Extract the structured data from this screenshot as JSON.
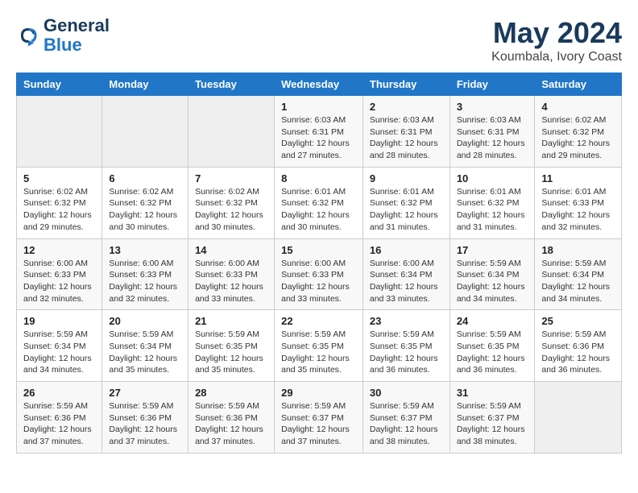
{
  "logo": {
    "line1": "General",
    "line2": "Blue"
  },
  "title": "May 2024",
  "subtitle": "Koumbala, Ivory Coast",
  "days_of_week": [
    "Sunday",
    "Monday",
    "Tuesday",
    "Wednesday",
    "Thursday",
    "Friday",
    "Saturday"
  ],
  "weeks": [
    [
      {
        "day": "",
        "sunrise": "",
        "sunset": "",
        "daylight": ""
      },
      {
        "day": "",
        "sunrise": "",
        "sunset": "",
        "daylight": ""
      },
      {
        "day": "",
        "sunrise": "",
        "sunset": "",
        "daylight": ""
      },
      {
        "day": "1",
        "sunrise": "Sunrise: 6:03 AM",
        "sunset": "Sunset: 6:31 PM",
        "daylight": "Daylight: 12 hours and 27 minutes."
      },
      {
        "day": "2",
        "sunrise": "Sunrise: 6:03 AM",
        "sunset": "Sunset: 6:31 PM",
        "daylight": "Daylight: 12 hours and 28 minutes."
      },
      {
        "day": "3",
        "sunrise": "Sunrise: 6:03 AM",
        "sunset": "Sunset: 6:31 PM",
        "daylight": "Daylight: 12 hours and 28 minutes."
      },
      {
        "day": "4",
        "sunrise": "Sunrise: 6:02 AM",
        "sunset": "Sunset: 6:32 PM",
        "daylight": "Daylight: 12 hours and 29 minutes."
      }
    ],
    [
      {
        "day": "5",
        "sunrise": "Sunrise: 6:02 AM",
        "sunset": "Sunset: 6:32 PM",
        "daylight": "Daylight: 12 hours and 29 minutes."
      },
      {
        "day": "6",
        "sunrise": "Sunrise: 6:02 AM",
        "sunset": "Sunset: 6:32 PM",
        "daylight": "Daylight: 12 hours and 30 minutes."
      },
      {
        "day": "7",
        "sunrise": "Sunrise: 6:02 AM",
        "sunset": "Sunset: 6:32 PM",
        "daylight": "Daylight: 12 hours and 30 minutes."
      },
      {
        "day": "8",
        "sunrise": "Sunrise: 6:01 AM",
        "sunset": "Sunset: 6:32 PM",
        "daylight": "Daylight: 12 hours and 30 minutes."
      },
      {
        "day": "9",
        "sunrise": "Sunrise: 6:01 AM",
        "sunset": "Sunset: 6:32 PM",
        "daylight": "Daylight: 12 hours and 31 minutes."
      },
      {
        "day": "10",
        "sunrise": "Sunrise: 6:01 AM",
        "sunset": "Sunset: 6:32 PM",
        "daylight": "Daylight: 12 hours and 31 minutes."
      },
      {
        "day": "11",
        "sunrise": "Sunrise: 6:01 AM",
        "sunset": "Sunset: 6:33 PM",
        "daylight": "Daylight: 12 hours and 32 minutes."
      }
    ],
    [
      {
        "day": "12",
        "sunrise": "Sunrise: 6:00 AM",
        "sunset": "Sunset: 6:33 PM",
        "daylight": "Daylight: 12 hours and 32 minutes."
      },
      {
        "day": "13",
        "sunrise": "Sunrise: 6:00 AM",
        "sunset": "Sunset: 6:33 PM",
        "daylight": "Daylight: 12 hours and 32 minutes."
      },
      {
        "day": "14",
        "sunrise": "Sunrise: 6:00 AM",
        "sunset": "Sunset: 6:33 PM",
        "daylight": "Daylight: 12 hours and 33 minutes."
      },
      {
        "day": "15",
        "sunrise": "Sunrise: 6:00 AM",
        "sunset": "Sunset: 6:33 PM",
        "daylight": "Daylight: 12 hours and 33 minutes."
      },
      {
        "day": "16",
        "sunrise": "Sunrise: 6:00 AM",
        "sunset": "Sunset: 6:34 PM",
        "daylight": "Daylight: 12 hours and 33 minutes."
      },
      {
        "day": "17",
        "sunrise": "Sunrise: 5:59 AM",
        "sunset": "Sunset: 6:34 PM",
        "daylight": "Daylight: 12 hours and 34 minutes."
      },
      {
        "day": "18",
        "sunrise": "Sunrise: 5:59 AM",
        "sunset": "Sunset: 6:34 PM",
        "daylight": "Daylight: 12 hours and 34 minutes."
      }
    ],
    [
      {
        "day": "19",
        "sunrise": "Sunrise: 5:59 AM",
        "sunset": "Sunset: 6:34 PM",
        "daylight": "Daylight: 12 hours and 34 minutes."
      },
      {
        "day": "20",
        "sunrise": "Sunrise: 5:59 AM",
        "sunset": "Sunset: 6:34 PM",
        "daylight": "Daylight: 12 hours and 35 minutes."
      },
      {
        "day": "21",
        "sunrise": "Sunrise: 5:59 AM",
        "sunset": "Sunset: 6:35 PM",
        "daylight": "Daylight: 12 hours and 35 minutes."
      },
      {
        "day": "22",
        "sunrise": "Sunrise: 5:59 AM",
        "sunset": "Sunset: 6:35 PM",
        "daylight": "Daylight: 12 hours and 35 minutes."
      },
      {
        "day": "23",
        "sunrise": "Sunrise: 5:59 AM",
        "sunset": "Sunset: 6:35 PM",
        "daylight": "Daylight: 12 hours and 36 minutes."
      },
      {
        "day": "24",
        "sunrise": "Sunrise: 5:59 AM",
        "sunset": "Sunset: 6:35 PM",
        "daylight": "Daylight: 12 hours and 36 minutes."
      },
      {
        "day": "25",
        "sunrise": "Sunrise: 5:59 AM",
        "sunset": "Sunset: 6:36 PM",
        "daylight": "Daylight: 12 hours and 36 minutes."
      }
    ],
    [
      {
        "day": "26",
        "sunrise": "Sunrise: 5:59 AM",
        "sunset": "Sunset: 6:36 PM",
        "daylight": "Daylight: 12 hours and 37 minutes."
      },
      {
        "day": "27",
        "sunrise": "Sunrise: 5:59 AM",
        "sunset": "Sunset: 6:36 PM",
        "daylight": "Daylight: 12 hours and 37 minutes."
      },
      {
        "day": "28",
        "sunrise": "Sunrise: 5:59 AM",
        "sunset": "Sunset: 6:36 PM",
        "daylight": "Daylight: 12 hours and 37 minutes."
      },
      {
        "day": "29",
        "sunrise": "Sunrise: 5:59 AM",
        "sunset": "Sunset: 6:37 PM",
        "daylight": "Daylight: 12 hours and 37 minutes."
      },
      {
        "day": "30",
        "sunrise": "Sunrise: 5:59 AM",
        "sunset": "Sunset: 6:37 PM",
        "daylight": "Daylight: 12 hours and 38 minutes."
      },
      {
        "day": "31",
        "sunrise": "Sunrise: 5:59 AM",
        "sunset": "Sunset: 6:37 PM",
        "daylight": "Daylight: 12 hours and 38 minutes."
      },
      {
        "day": "",
        "sunrise": "",
        "sunset": "",
        "daylight": ""
      }
    ]
  ]
}
